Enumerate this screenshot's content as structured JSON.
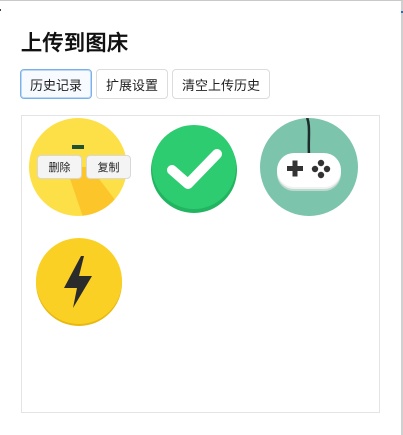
{
  "title": "上传到图床",
  "tabs": [
    {
      "label": "历史记录",
      "active": true
    },
    {
      "label": "扩展设置",
      "active": false
    },
    {
      "label": "清空上传历史",
      "active": false
    }
  ],
  "images": [
    {
      "icon": "yellow-circle-icon",
      "hover_actions": {
        "delete_label": "删除",
        "copy_label": "复制"
      }
    },
    {
      "icon": "green-check-icon"
    },
    {
      "icon": "gamepad-icon"
    },
    {
      "icon": "lightning-bolt-icon"
    }
  ],
  "colors": {
    "tab_active_border": "#7ab0ea",
    "yellow": "#fde047",
    "green": "#2dcc70",
    "teal": "#7dc4ad",
    "amber": "#fbd025"
  }
}
